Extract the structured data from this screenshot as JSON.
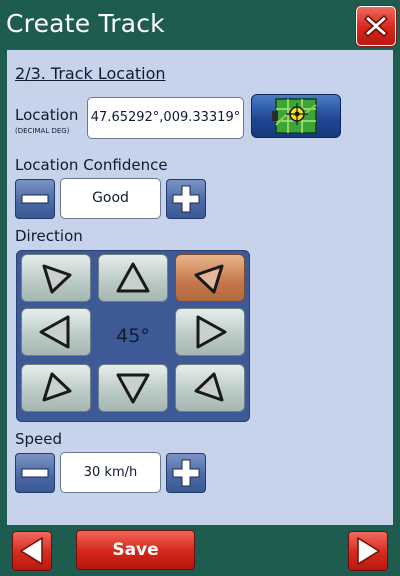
{
  "window": {
    "title": "Create Track"
  },
  "step": {
    "label": "2/3. Track Location"
  },
  "location": {
    "label": "Location",
    "sublabel": "(DECIMAL DEG)",
    "value": "47.65292°,009.33319°"
  },
  "confidence": {
    "label": "Location Confidence",
    "value": "Good"
  },
  "direction": {
    "label": "Direction",
    "value": "45°",
    "selected": "north-east"
  },
  "speed": {
    "label": "Speed",
    "value": "30 km/h"
  },
  "footer": {
    "save_label": "Save"
  },
  "icons": {
    "close": "close-icon",
    "map": "map-icon",
    "minus": "minus-icon",
    "plus": "plus-icon",
    "prev": "arrow-left-icon",
    "next": "arrow-right-icon"
  },
  "colors": {
    "background": "#1f5c50",
    "panel": "#c6d3ea",
    "accent_red": "#d42619",
    "selected_direction": "#c5774a"
  }
}
